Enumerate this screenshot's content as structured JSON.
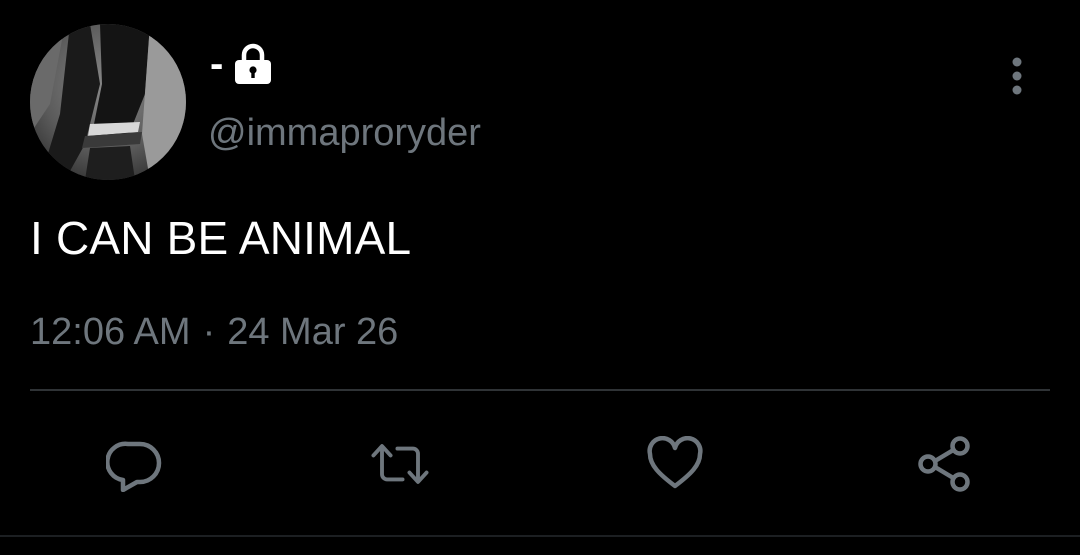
{
  "tweet": {
    "display_name": "-",
    "handle": "@immaproryder",
    "text": "I CAN BE ANIMAL",
    "time": "12:06 AM",
    "separator": "·",
    "date": "24 Mar 26",
    "protected_icon": "lock-icon"
  },
  "actions": {
    "reply_icon": "reply-icon",
    "retweet_icon": "retweet-icon",
    "like_icon": "heart-icon",
    "share_icon": "share-icon",
    "more_icon": "more-vertical-icon"
  },
  "colors": {
    "background": "#000000",
    "primary_text": "#ffffff",
    "secondary_text": "#6e767d",
    "divider": "#2f3336"
  }
}
